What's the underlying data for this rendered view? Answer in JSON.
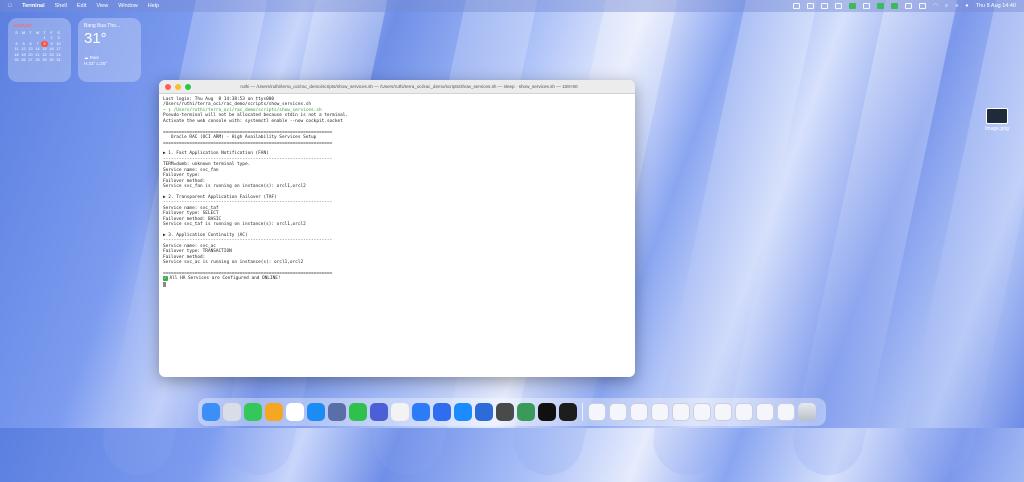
{
  "menubar": {
    "app": "Terminal",
    "items": [
      "Shell",
      "Edit",
      "View",
      "Window",
      "Help"
    ],
    "clock": "Thu 8 Aug  14:40"
  },
  "calendar": {
    "month": "AUGUST",
    "weekdays": [
      "S",
      "M",
      "T",
      "W",
      "T",
      "F",
      "S"
    ],
    "rows": [
      [
        "",
        "",
        "",
        "",
        "1",
        "2",
        "3"
      ],
      [
        "4",
        "5",
        "6",
        "7",
        "8",
        "9",
        "10"
      ],
      [
        "11",
        "12",
        "13",
        "14",
        "15",
        "16",
        "17"
      ],
      [
        "18",
        "19",
        "20",
        "21",
        "22",
        "23",
        "24"
      ],
      [
        "25",
        "26",
        "27",
        "28",
        "29",
        "30",
        "31"
      ]
    ],
    "today": "8"
  },
  "weather": {
    "city": "Bang Bua Tho...",
    "temp": "31°",
    "condition": "Rain",
    "hilo": "H:33° L:26°"
  },
  "terminal": {
    "title": "ruthi — /Users/ruthi/terra_oci/rac_demo/scripts/show_services.sh — /Users/ruthi/terra_oci/rac_demo/scripts/show_services.sh — sleep · show_services.sh — 108×50",
    "lines": [
      "Last login: Thu Aug  8 14:38:53 on ttys000",
      "/Users/ruthi/terra_oci/rac_demo/scripts/show_services.sh",
      "~ ❯ /Users/ruthi/terra_oci/rac_demo/scripts/show_services.sh",
      "Pseudo-terminal will not be allocated because stdin is not a terminal.",
      "Activate the web console with: systemctl enable --now cockpit.socket",
      "",
      "================================================================",
      "   Oracle RAC (OCI ARM) - High Availability Services Setup",
      "================================================================",
      "",
      "▶ 1. Fast Application Notification (FAN)",
      "----------------------------------------------------------------",
      "TERM=dumb: unknown terminal type.",
      "Service name: svc_fan",
      "Failover type:",
      "Failover method:",
      "Service svc_fan is running on instance(s): orcl1,orcl2",
      "",
      "▶ 2. Transparent Application Failover (TAF)",
      "----------------------------------------------------------------",
      "Service name: svc_taf",
      "Failover type: SELECT",
      "Failover method: BASIC",
      "Service svc_taf is running on instance(s): orcl1,orcl2",
      "",
      "▶ 3. Application Continuity (AC)",
      "----------------------------------------------------------------",
      "Service name: svc_ac",
      "Failover type: TRANSACTION",
      "Failover method:",
      "Service svc_ac is running on instance(s): orcl1,orcl2",
      "",
      "================================================================",
      "All HA Services are Configured and ONLINE!"
    ]
  },
  "desktop_icon": {
    "label": "Image.png"
  },
  "dock": {
    "apps": [
      "Finder",
      "Launchpad",
      "Messages",
      "Photos",
      "Reminders",
      "App Store",
      "Preview",
      "LINE",
      "Screenshot",
      "Notes",
      "Safari Technology",
      "TestFlight",
      "Safari",
      "Zoom",
      "Gauge",
      "Activity Monitor",
      "QuickTime",
      "Terminal"
    ],
    "docs": [
      "Document 1",
      "Document 2",
      "Document 3",
      "Document 4",
      "Document 5",
      "Document 6",
      "Document 7",
      "Document 8",
      "Document 9",
      "Document 10"
    ],
    "trash": "Trash"
  },
  "colors": {
    "accent_green": "#2f9e3a",
    "close": "#ff5f57",
    "minimize": "#febc2e",
    "zoom": "#28c840"
  }
}
